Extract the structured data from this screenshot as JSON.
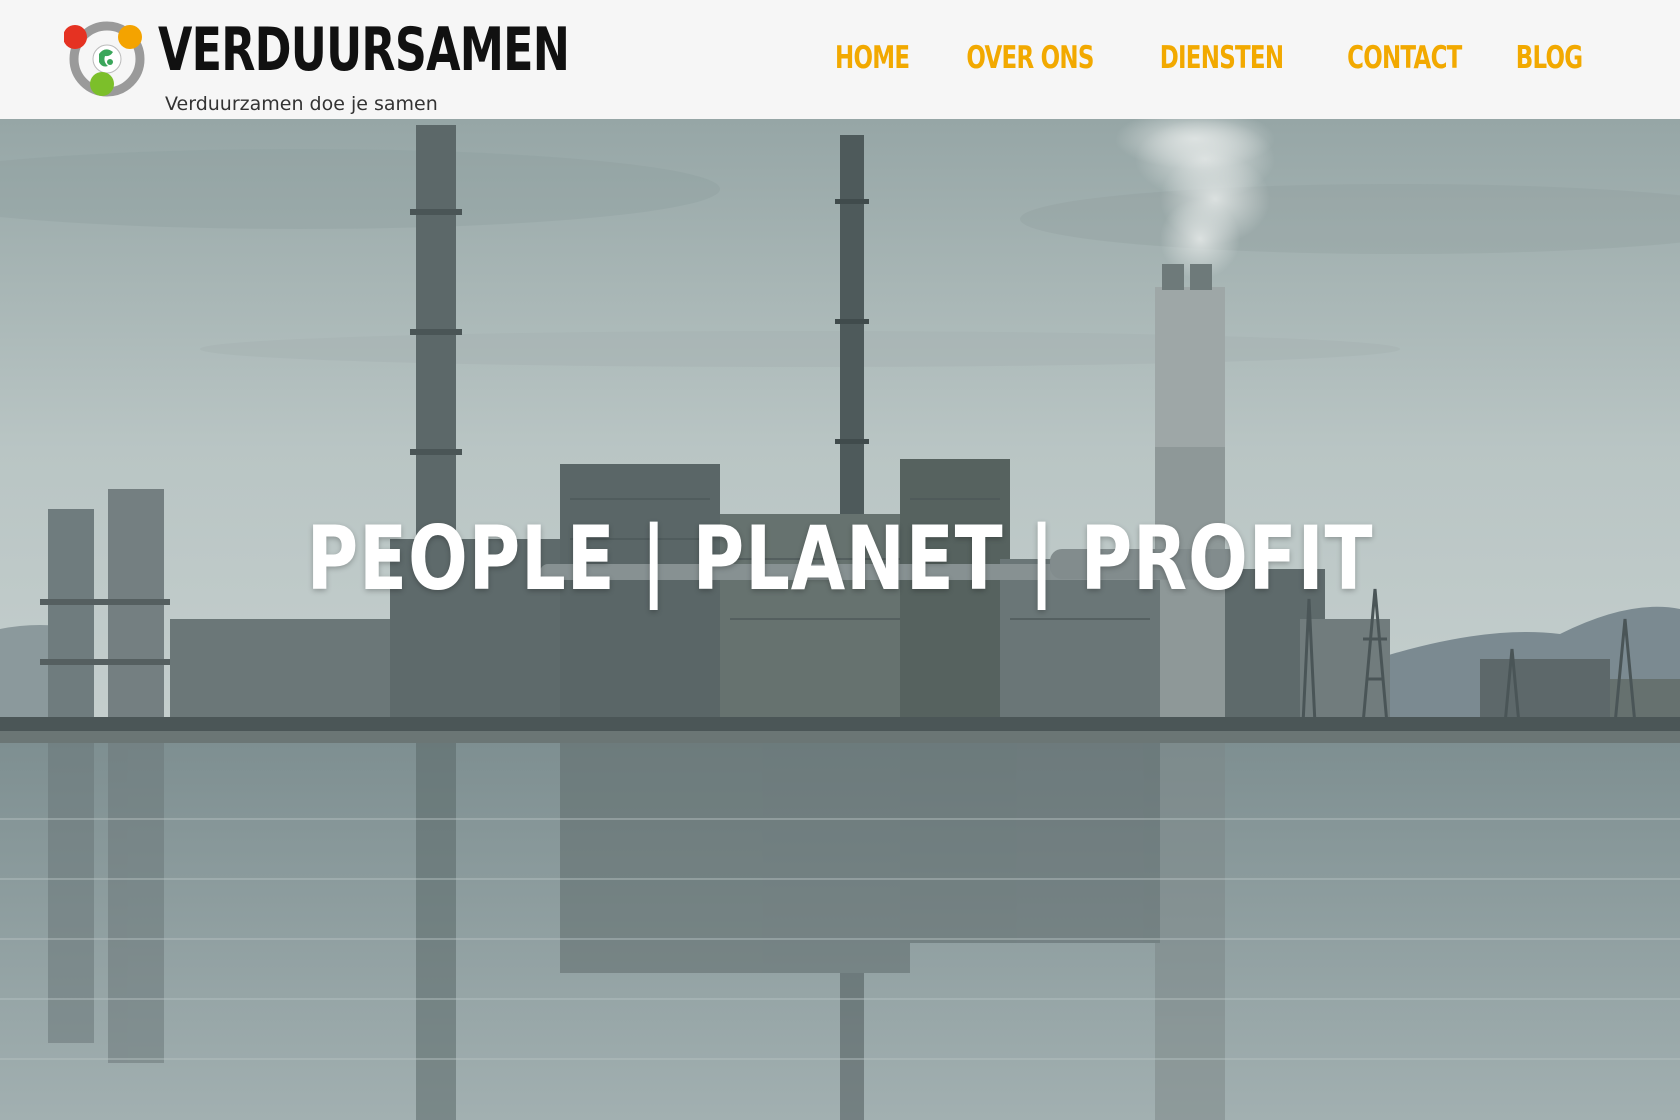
{
  "colors": {
    "brand_accent": "#f2a900",
    "header_background": "#f6f6f6",
    "logo_text": "#111111",
    "logo_red_dot": "#e53222",
    "logo_orange_dot": "#f4a300",
    "logo_green_dot": "#7cbf2a",
    "logo_ring": "#9a9a9a"
  },
  "header": {
    "logo": {
      "title": "VERDUURSAMEN",
      "tagline": "Verduurzamen doe je samen",
      "icon": "globe-ring-logo-icon"
    },
    "nav": [
      {
        "label": "HOME"
      },
      {
        "label": "OVER ONS"
      },
      {
        "label": "DIENSTEN"
      },
      {
        "label": "CONTACT"
      },
      {
        "label": "BLOG"
      }
    ]
  },
  "hero": {
    "title": "PEOPLE | PLANET | PROFIT",
    "background": "power-plant-with-smokestacks-by-water-photo"
  }
}
